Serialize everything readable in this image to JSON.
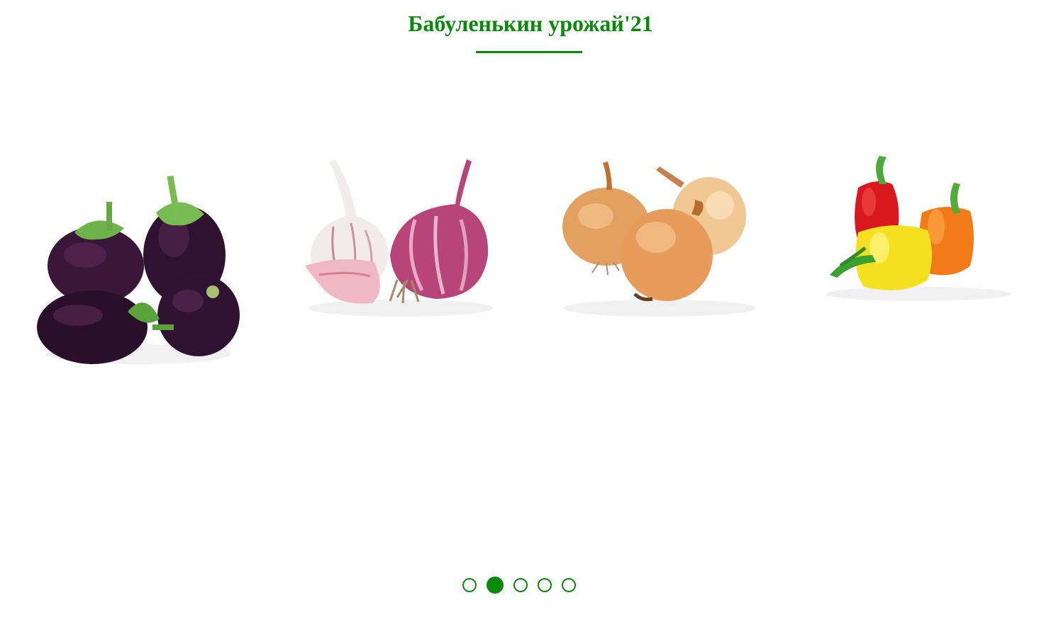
{
  "header": {
    "title": "Бабуленькин урожай'21"
  },
  "carousel": {
    "slides": [
      {
        "name": "eggplant-image"
      },
      {
        "name": "garlic-image"
      },
      {
        "name": "onion-image"
      },
      {
        "name": "bell-pepper-image"
      }
    ],
    "dots_count": 5,
    "active_index": 1
  },
  "colors": {
    "accent": "#0a8a0a"
  }
}
